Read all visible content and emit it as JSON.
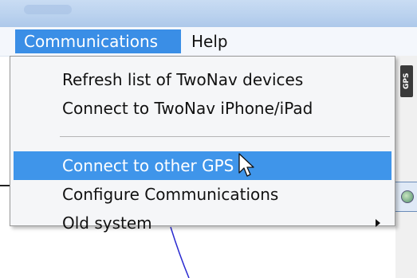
{
  "menubar": {
    "items": [
      {
        "label": "Communications",
        "active": true
      },
      {
        "label": "Help",
        "active": false
      }
    ]
  },
  "side_badge": "GPS",
  "dropdown": {
    "items": [
      {
        "label": "Refresh list of TwoNav devices"
      },
      {
        "label": "Connect to TwoNav iPhone/iPad"
      },
      {
        "label": "Connect to other GPS",
        "highlighted": true
      },
      {
        "label": "Configure Communications"
      },
      {
        "label": "Old system",
        "has_submenu": true
      }
    ]
  },
  "colors": {
    "highlight": "#3f95ea",
    "menu_active": "#3a8ee6",
    "menu_bg": "#f5f6f8",
    "map_line": "#2a2ad0"
  },
  "icons": [
    "mouse-cursor-icon",
    "submenu-arrow-icon",
    "globe-icon"
  ]
}
